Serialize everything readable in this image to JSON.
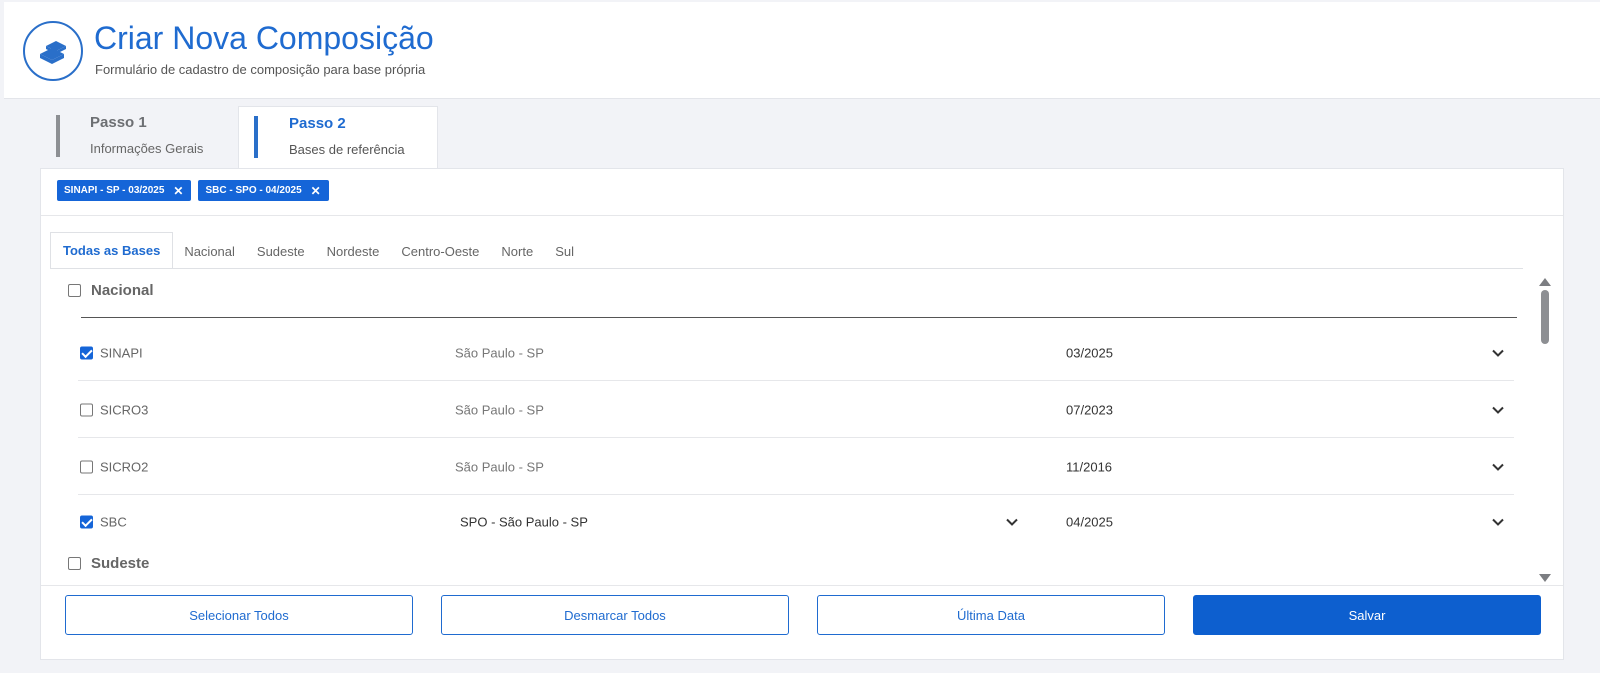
{
  "header": {
    "title": "Criar Nova Composição",
    "subtitle": "Formulário de cadastro de composição para base própria"
  },
  "steps": [
    {
      "title": "Passo 1",
      "subtitle": "Informações Gerais",
      "active": false
    },
    {
      "title": "Passo 2",
      "subtitle": "Bases de referência",
      "active": true
    }
  ],
  "chips": [
    {
      "label": "SINAPI - SP - 03/2025"
    },
    {
      "label": "SBC - SPO - 04/2025"
    }
  ],
  "tabs": [
    {
      "label": "Todas as Bases",
      "active": true
    },
    {
      "label": "Nacional"
    },
    {
      "label": "Sudeste"
    },
    {
      "label": "Nordeste"
    },
    {
      "label": "Centro-Oeste"
    },
    {
      "label": "Norte"
    },
    {
      "label": "Sul"
    }
  ],
  "groups": [
    {
      "label": "Nacional",
      "checked": false,
      "rows": [
        {
          "name": "SINAPI",
          "checked": true,
          "location": "São Paulo - SP",
          "date": "03/2025"
        },
        {
          "name": "SICRO3",
          "checked": false,
          "location": "São Paulo - SP",
          "date": "07/2023"
        },
        {
          "name": "SICRO2",
          "checked": false,
          "location": "São Paulo - SP",
          "date": "11/2016"
        },
        {
          "name": "SBC",
          "checked": true,
          "location": "SPO - São Paulo - SP",
          "date": "04/2025"
        }
      ]
    },
    {
      "label": "Sudeste",
      "checked": false
    }
  ],
  "buttons": {
    "select_all": "Selecionar Todos",
    "deselect_all": "Desmarcar Todos",
    "last_date": "Última Data",
    "save": "Salvar"
  },
  "colors": {
    "primary": "#1565d8",
    "title": "#1f6bd0"
  }
}
